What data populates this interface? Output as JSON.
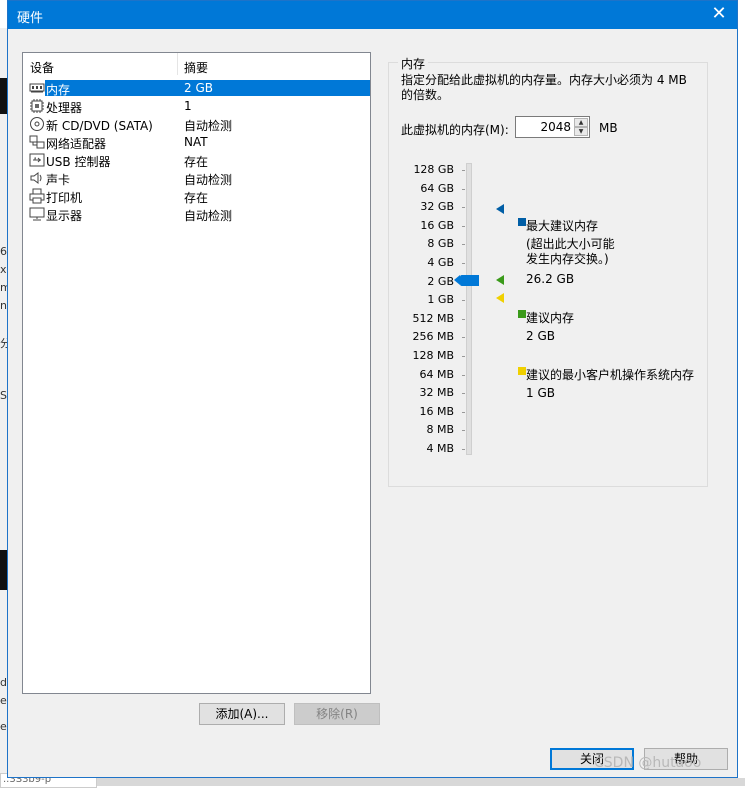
{
  "window": {
    "title": "硬件",
    "close_glyph": "✕"
  },
  "devices": {
    "columns": [
      "设备",
      "摘要"
    ],
    "rows": [
      {
        "name": "内存",
        "summary": "2 GB",
        "icon": "memory-icon",
        "selected": true
      },
      {
        "name": "处理器",
        "summary": "1",
        "icon": "processor-icon"
      },
      {
        "name": "新 CD/DVD (SATA)",
        "summary": "自动检测",
        "icon": "cd-dvd-icon"
      },
      {
        "name": "网络适配器",
        "summary": "NAT",
        "icon": "network-adapter-icon"
      },
      {
        "name": "USB 控制器",
        "summary": "存在",
        "icon": "usb-icon"
      },
      {
        "name": "声卡",
        "summary": "自动检测",
        "icon": "sound-card-icon"
      },
      {
        "name": "打印机",
        "summary": "存在",
        "icon": "printer-icon"
      },
      {
        "name": "显示器",
        "summary": "自动检测",
        "icon": "display-icon"
      }
    ],
    "add_label": "添加(A)...",
    "remove_label": "移除(R)"
  },
  "memory": {
    "group_title": "内存",
    "description": "指定分配给此虚拟机的内存量。内存大小必须为 4 MB 的倍数。",
    "field_label": "此虚拟机的内存(M):",
    "value": "2048",
    "unit": "MB",
    "scale_labels": [
      "128 GB",
      "64 GB",
      "32 GB",
      "16 GB",
      "8 GB",
      "4 GB",
      "2 GB",
      "1 GB",
      "512 MB",
      "256 MB",
      "128 MB",
      "64 MB",
      "32 MB",
      "16 MB",
      "8 MB",
      "4 MB"
    ],
    "max_recommended": {
      "label": "最大建议内存",
      "note": "(超出此大小可能\n发生内存交换。)",
      "value": "26.2 GB",
      "color": "#005ea6"
    },
    "recommended": {
      "label": "建议内存",
      "value": "2 GB",
      "color": "#3a9a1a"
    },
    "min_guest": {
      "label": "建议的最小客户机操作系统内存",
      "value": "1 GB",
      "color": "#f0d000"
    },
    "accent": "#0078d7"
  },
  "footer": {
    "close_label": "关闭",
    "help_label": "帮助"
  },
  "background": {
    "watermark": "CSDN @hutaoo",
    "snippets": [
      "d",
      "6",
      "xi",
      "m",
      "nt",
      "分",
      "S",
      "d",
      "e",
      "e",
      "..3S3b9-p"
    ]
  }
}
